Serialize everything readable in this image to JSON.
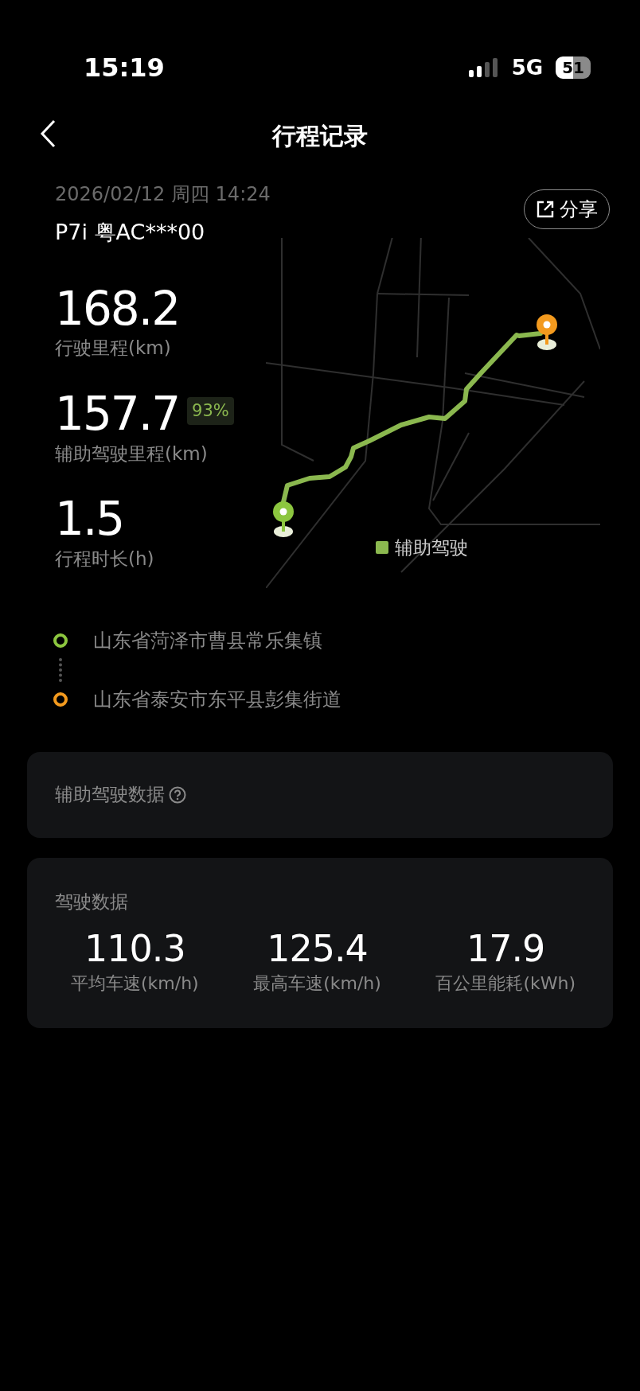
{
  "status_bar": {
    "time": "15:19",
    "network": "5G",
    "battery": "51"
  },
  "header": {
    "title": "行程记录"
  },
  "trip": {
    "datetime": "2026/02/12 周四 14:24",
    "vehicle": "P7i 粤AC***00",
    "share_label": "分享"
  },
  "stats": [
    {
      "value": "168.2",
      "label": "行驶里程(km)"
    },
    {
      "value": "157.7",
      "label": "辅助驾驶里程(km)",
      "badge": "93%"
    },
    {
      "value": "1.5",
      "label": "行程时长(h)"
    }
  ],
  "map": {
    "legend": [
      {
        "label": "辅助驾驶",
        "color": "#8bb84f"
      }
    ]
  },
  "locations": [
    {
      "name": "山东省菏泽市曹县常乐集镇",
      "color": "#8cc63f"
    },
    {
      "name": "山东省泰安市东平县彭集街道",
      "color": "#f39a1e"
    }
  ],
  "assist_card": {
    "title": "辅助驾驶数据"
  },
  "driving_card": {
    "title": "驾驶数据",
    "metrics": [
      {
        "value": "110.3",
        "label": "平均车速(km/h)"
      },
      {
        "value": "125.4",
        "label": "最高车速(km/h)"
      },
      {
        "value": "17.9",
        "label": "百公里能耗(kWh)"
      }
    ]
  }
}
